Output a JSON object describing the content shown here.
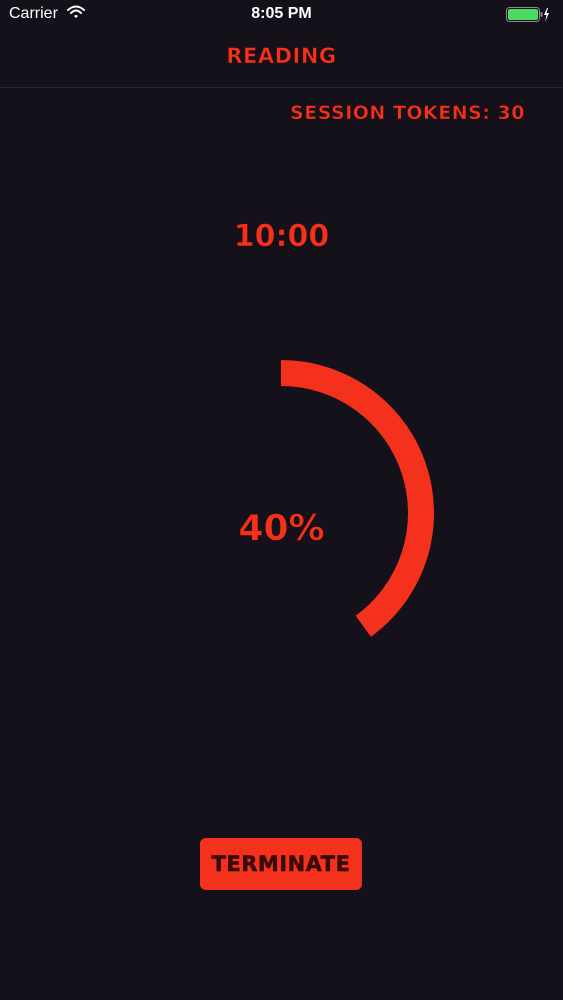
{
  "status_bar": {
    "carrier": "Carrier",
    "time": "8:05 PM",
    "wifi_icon": "wifi-icon",
    "battery_icon": "battery-charging-icon",
    "battery_color": "#4cd964"
  },
  "nav": {
    "title": "Reading"
  },
  "session": {
    "tokens_label": "Session Tokens: 30"
  },
  "timer": {
    "display": "10:00"
  },
  "progress": {
    "value": 0.4,
    "label": "40%",
    "color": "#f4311c"
  },
  "actions": {
    "terminate_label": "Terminate"
  },
  "theme": {
    "accent": "#f4311c",
    "background": "#15111a"
  }
}
